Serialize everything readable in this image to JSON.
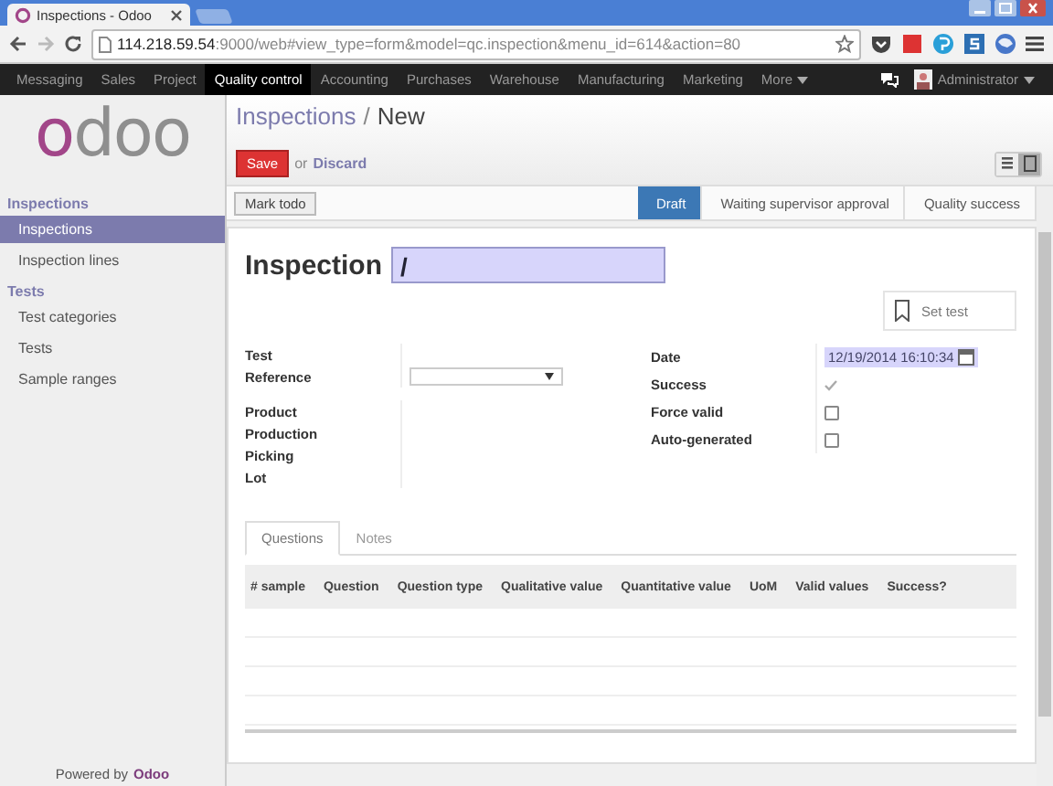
{
  "browser": {
    "tab_title": "Inspections - Odoo",
    "url_host": "114.218.59.54",
    "url_rest": ":9000/web#view_type=form&model=qc.inspection&menu_id=614&action=80"
  },
  "top_menu": {
    "items": [
      {
        "label": "Messaging",
        "selected": false
      },
      {
        "label": "Sales",
        "selected": false
      },
      {
        "label": "Project",
        "selected": false
      },
      {
        "label": "Quality control",
        "selected": true
      },
      {
        "label": "Accounting",
        "selected": false
      },
      {
        "label": "Purchases",
        "selected": false
      },
      {
        "label": "Warehouse",
        "selected": false
      },
      {
        "label": "Manufacturing",
        "selected": false
      },
      {
        "label": "Marketing",
        "selected": false
      },
      {
        "label": "More",
        "selected": false
      }
    ],
    "user": "Administrator"
  },
  "sidebar": {
    "logo": "odoo",
    "sections": [
      {
        "title": "Inspections",
        "items": [
          {
            "label": "Inspections",
            "selected": true
          },
          {
            "label": "Inspection lines",
            "selected": false
          }
        ]
      },
      {
        "title": "Tests",
        "items": [
          {
            "label": "Test categories",
            "selected": false
          },
          {
            "label": "Tests",
            "selected": false
          },
          {
            "label": "Sample ranges",
            "selected": false
          }
        ]
      }
    ],
    "footer": "Powered by",
    "footer_brand": "Odoo"
  },
  "breadcrumb": {
    "parent": "Inspections",
    "separator": "/",
    "current": "New"
  },
  "actions": {
    "save": "Save",
    "or": "or",
    "discard": "Discard"
  },
  "view_modes": [
    {
      "kind": "list",
      "selected": false
    },
    {
      "kind": "form",
      "selected": true
    }
  ],
  "header_button": "Mark todo",
  "stages": [
    {
      "label": "Draft",
      "selected": true
    },
    {
      "label": "Waiting supervisor approval",
      "selected": false
    },
    {
      "label": "Quality success",
      "selected": false
    }
  ],
  "form": {
    "title": "Inspection",
    "name": "/",
    "set_test": "Set test",
    "left_fields": [
      {
        "label": "Test",
        "kind": "empty"
      },
      {
        "label": "Reference",
        "kind": "select"
      },
      {
        "label": "Product",
        "kind": "empty"
      },
      {
        "label": "Production",
        "kind": "empty"
      },
      {
        "label": "Picking",
        "kind": "empty"
      },
      {
        "label": "Lot",
        "kind": "empty"
      }
    ],
    "right_fields": [
      {
        "label": "Date",
        "kind": "datetime",
        "value": "12/19/2014 16:10:34"
      },
      {
        "label": "Success",
        "kind": "checkbox",
        "checked": true,
        "disabled": true
      },
      {
        "label": "Force valid",
        "kind": "checkbox",
        "checked": false,
        "disabled": false
      },
      {
        "label": "Auto-generated",
        "kind": "checkbox",
        "checked": false,
        "disabled": false
      }
    ]
  },
  "notebook": {
    "tabs": [
      {
        "label": "Questions",
        "selected": true
      },
      {
        "label": "Notes",
        "selected": false
      }
    ],
    "table": {
      "columns": [
        "# sample",
        "Question",
        "Question type",
        "Qualitative value",
        "Quantitative value",
        "UoM",
        "Valid values",
        "Success?"
      ]
    }
  }
}
